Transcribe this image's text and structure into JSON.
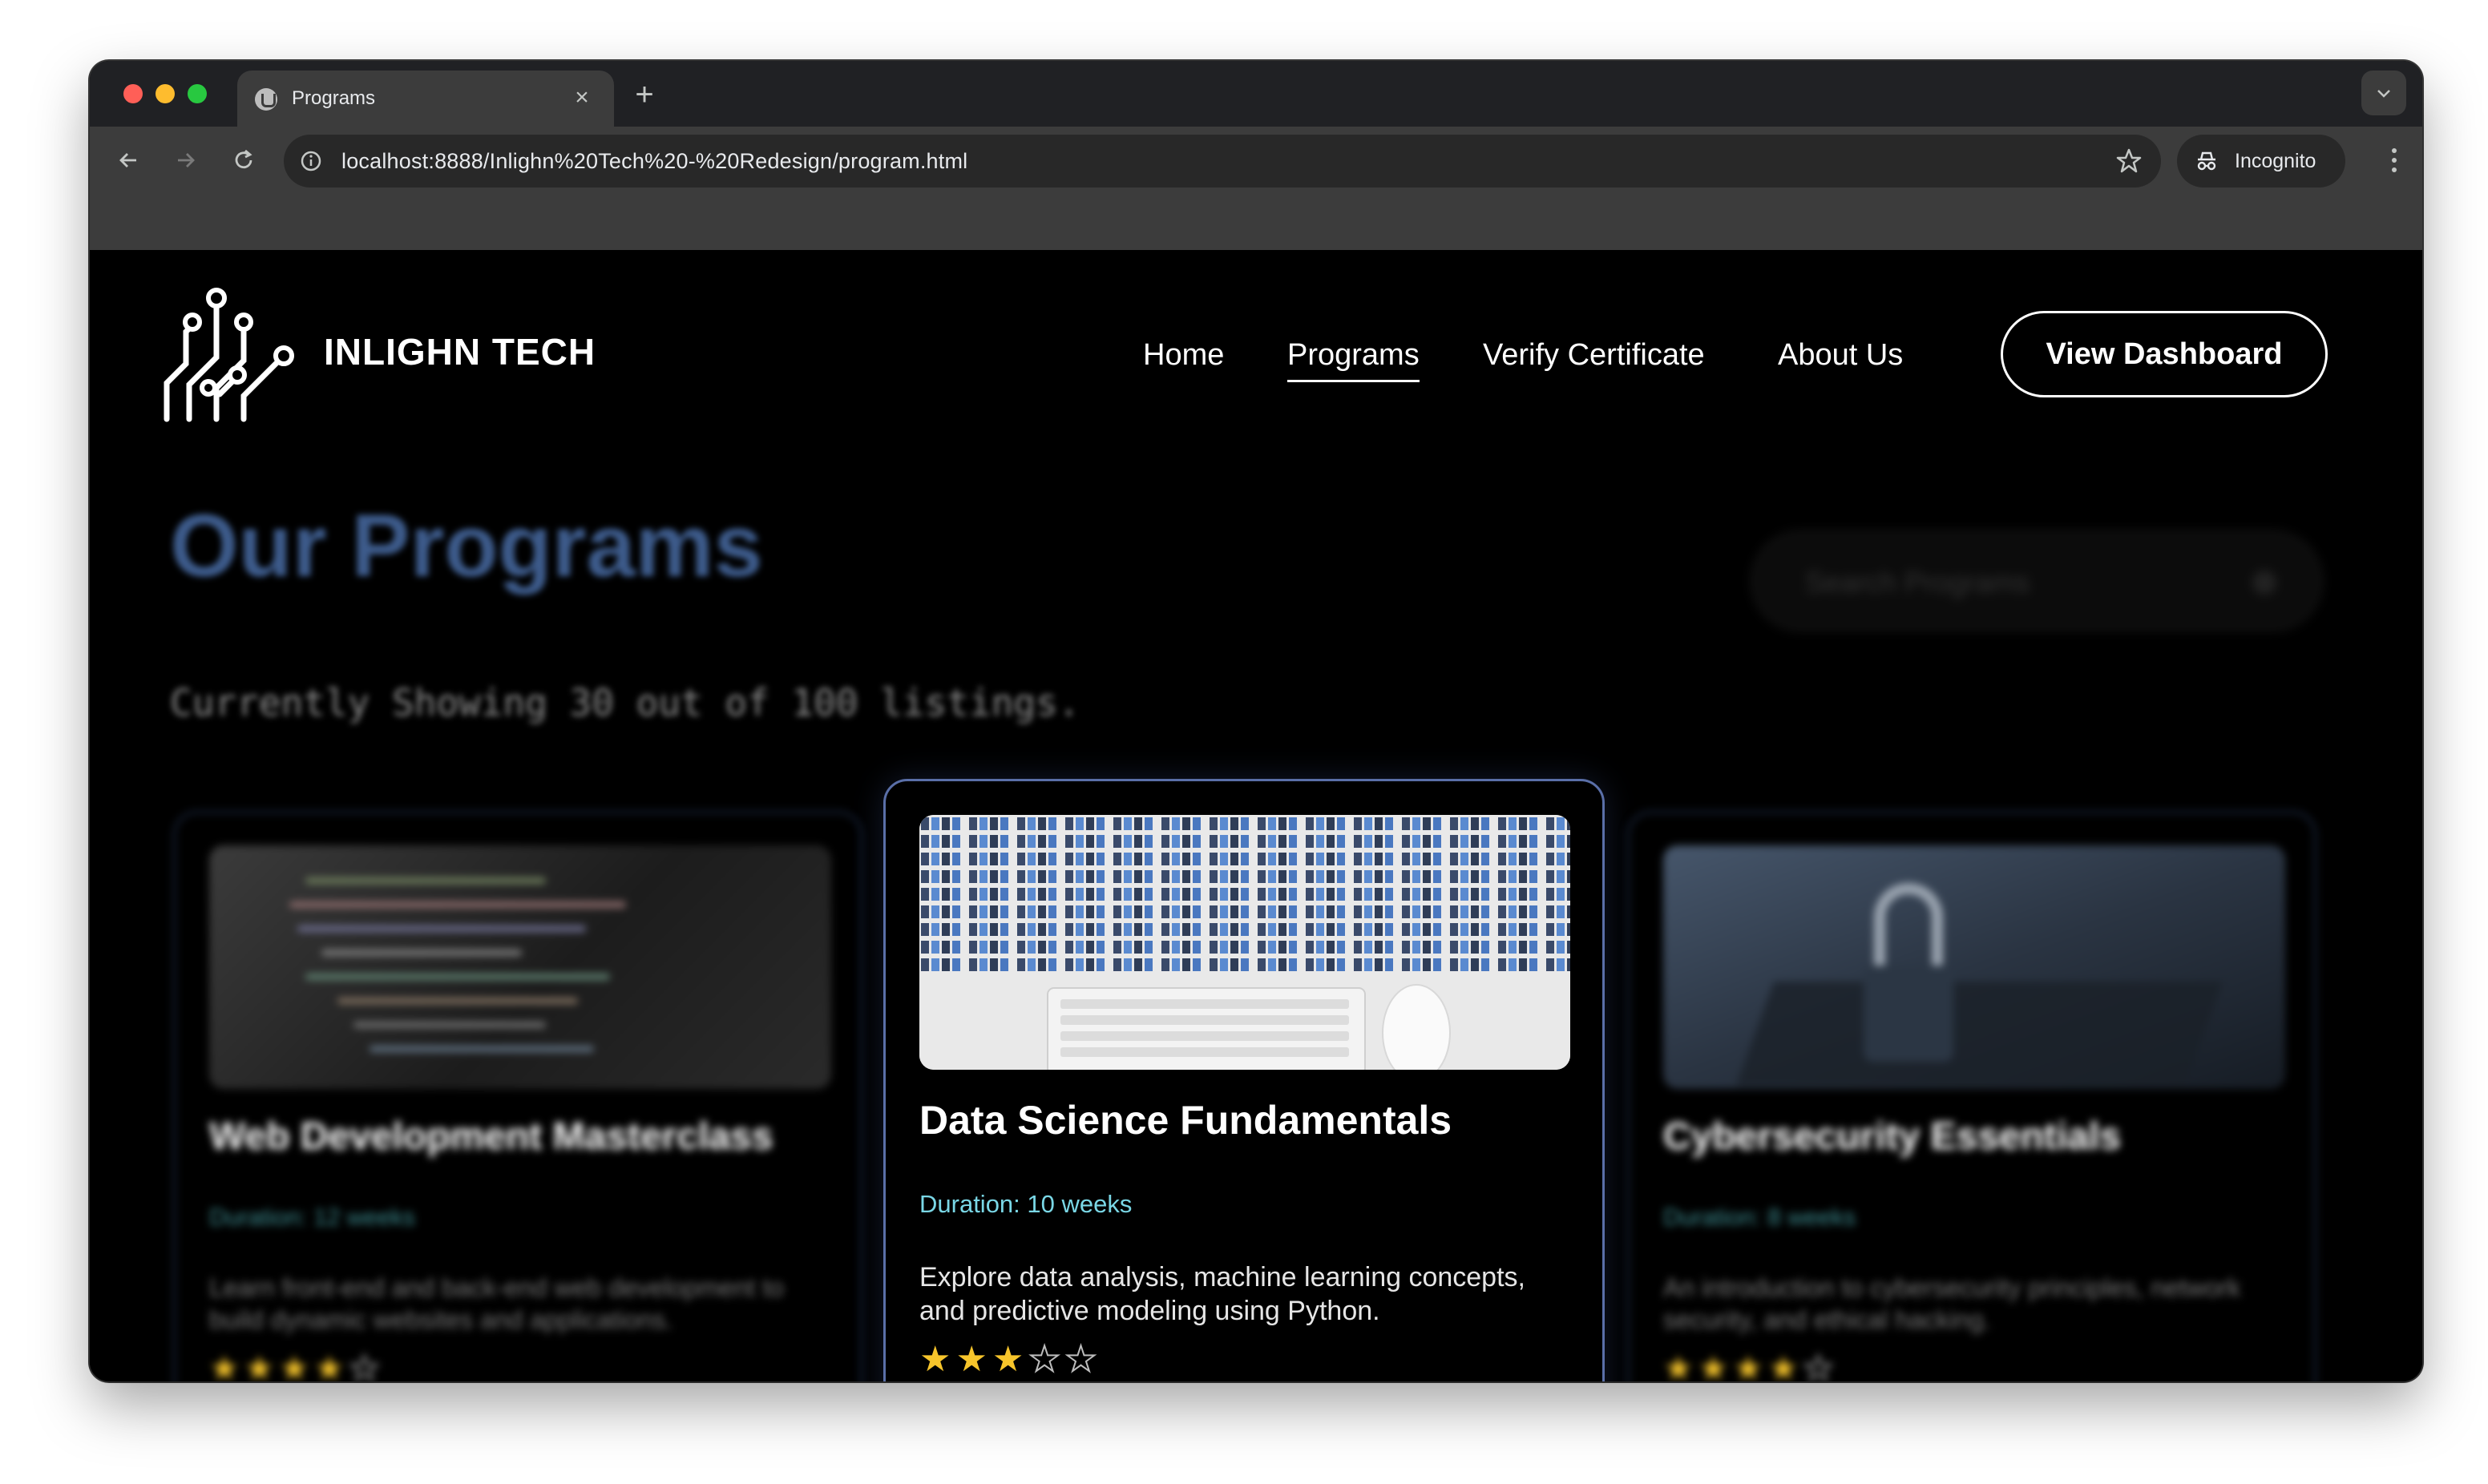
{
  "browser": {
    "tab_title": "Programs",
    "tab_close": "×",
    "new_tab": "+",
    "url": "localhost:8888/Inlighn%20Tech%20-%20Redesign/program.html",
    "incognito_label": "Incognito"
  },
  "header": {
    "brand": "INLIGHN TECH",
    "nav": [
      "Home",
      "Programs",
      "Verify Certificate",
      "About Us"
    ],
    "active_nav": "Programs",
    "cta": "View Dashboard"
  },
  "hero": {
    "title": "Our Programs",
    "subtitle": "Currently Showing 30 out of 100 listings.",
    "search_placeholder": "Search Programs"
  },
  "cards": [
    {
      "title": "Web Development Masterclass",
      "duration": "Duration: 12 weeks",
      "description": "Learn front-end and back-end web development to build dynamic websites and applications.",
      "rating": 4,
      "rating_stars": "★★★★☆",
      "image": "code-on-laptop"
    },
    {
      "title": "Data Science Fundamentals",
      "duration": "Duration: 10 weeks",
      "description": "Explore data analysis, machine learning concepts, and predictive modeling using Python.",
      "rating": 3,
      "rating_stars": "★★★☆☆",
      "image": "data-numbers-keyboard"
    },
    {
      "title": "Cybersecurity Essentials",
      "duration": "Duration: 8 weeks",
      "description": "An introduction to cybersecurity principles, network security, and ethical hacking.",
      "rating": 4,
      "rating_stars": "★★★★☆",
      "image": "padlock-on-keyboard"
    }
  ],
  "colors": {
    "heading": "#3d5b8b",
    "duration": "#7ad7e6",
    "star": "#f7c52b",
    "card_border_active": "#5a6fa8"
  }
}
